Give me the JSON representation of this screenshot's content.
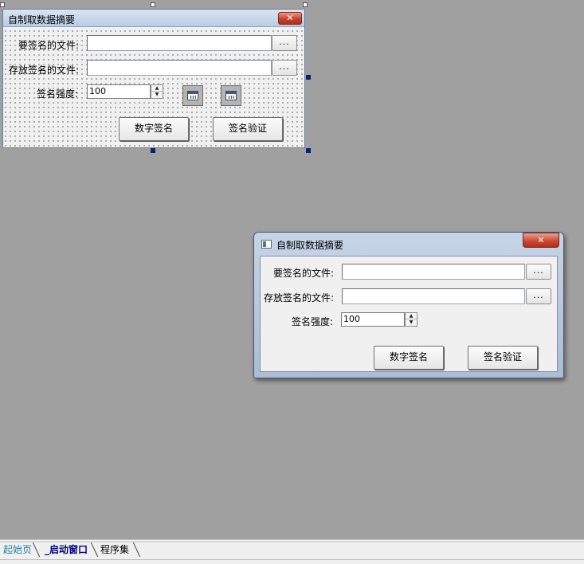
{
  "design_form": {
    "title": "自制取数据摘要",
    "close_label": "✕",
    "file_to_sign_label": "要签名的文件:",
    "signature_file_label": "存放签名的文件:",
    "browse_label": "...",
    "strength_label": "签名强度:",
    "strength_value": "100",
    "sign_button": "数字签名",
    "verify_button": "签名验证"
  },
  "run_window": {
    "title": "自制取数据摘要",
    "close_label": "✕",
    "file_to_sign_label": "要签名的文件:",
    "signature_file_label": "存放签名的文件:",
    "browse_label": "...",
    "strength_label": "签名强度:",
    "strength_value": "100",
    "sign_button": "数字签名",
    "verify_button": "签名验证"
  },
  "tabs": [
    {
      "label": "起始页",
      "active": false,
      "color": "#1a7fa8"
    },
    {
      "label": "_启动窗口",
      "active": true,
      "color": "#000080"
    },
    {
      "label": "程序集",
      "active": false,
      "color": "#000000"
    }
  ],
  "colors": {
    "workspace": "#a0a0a0",
    "selection_handle": "#0a246a"
  }
}
